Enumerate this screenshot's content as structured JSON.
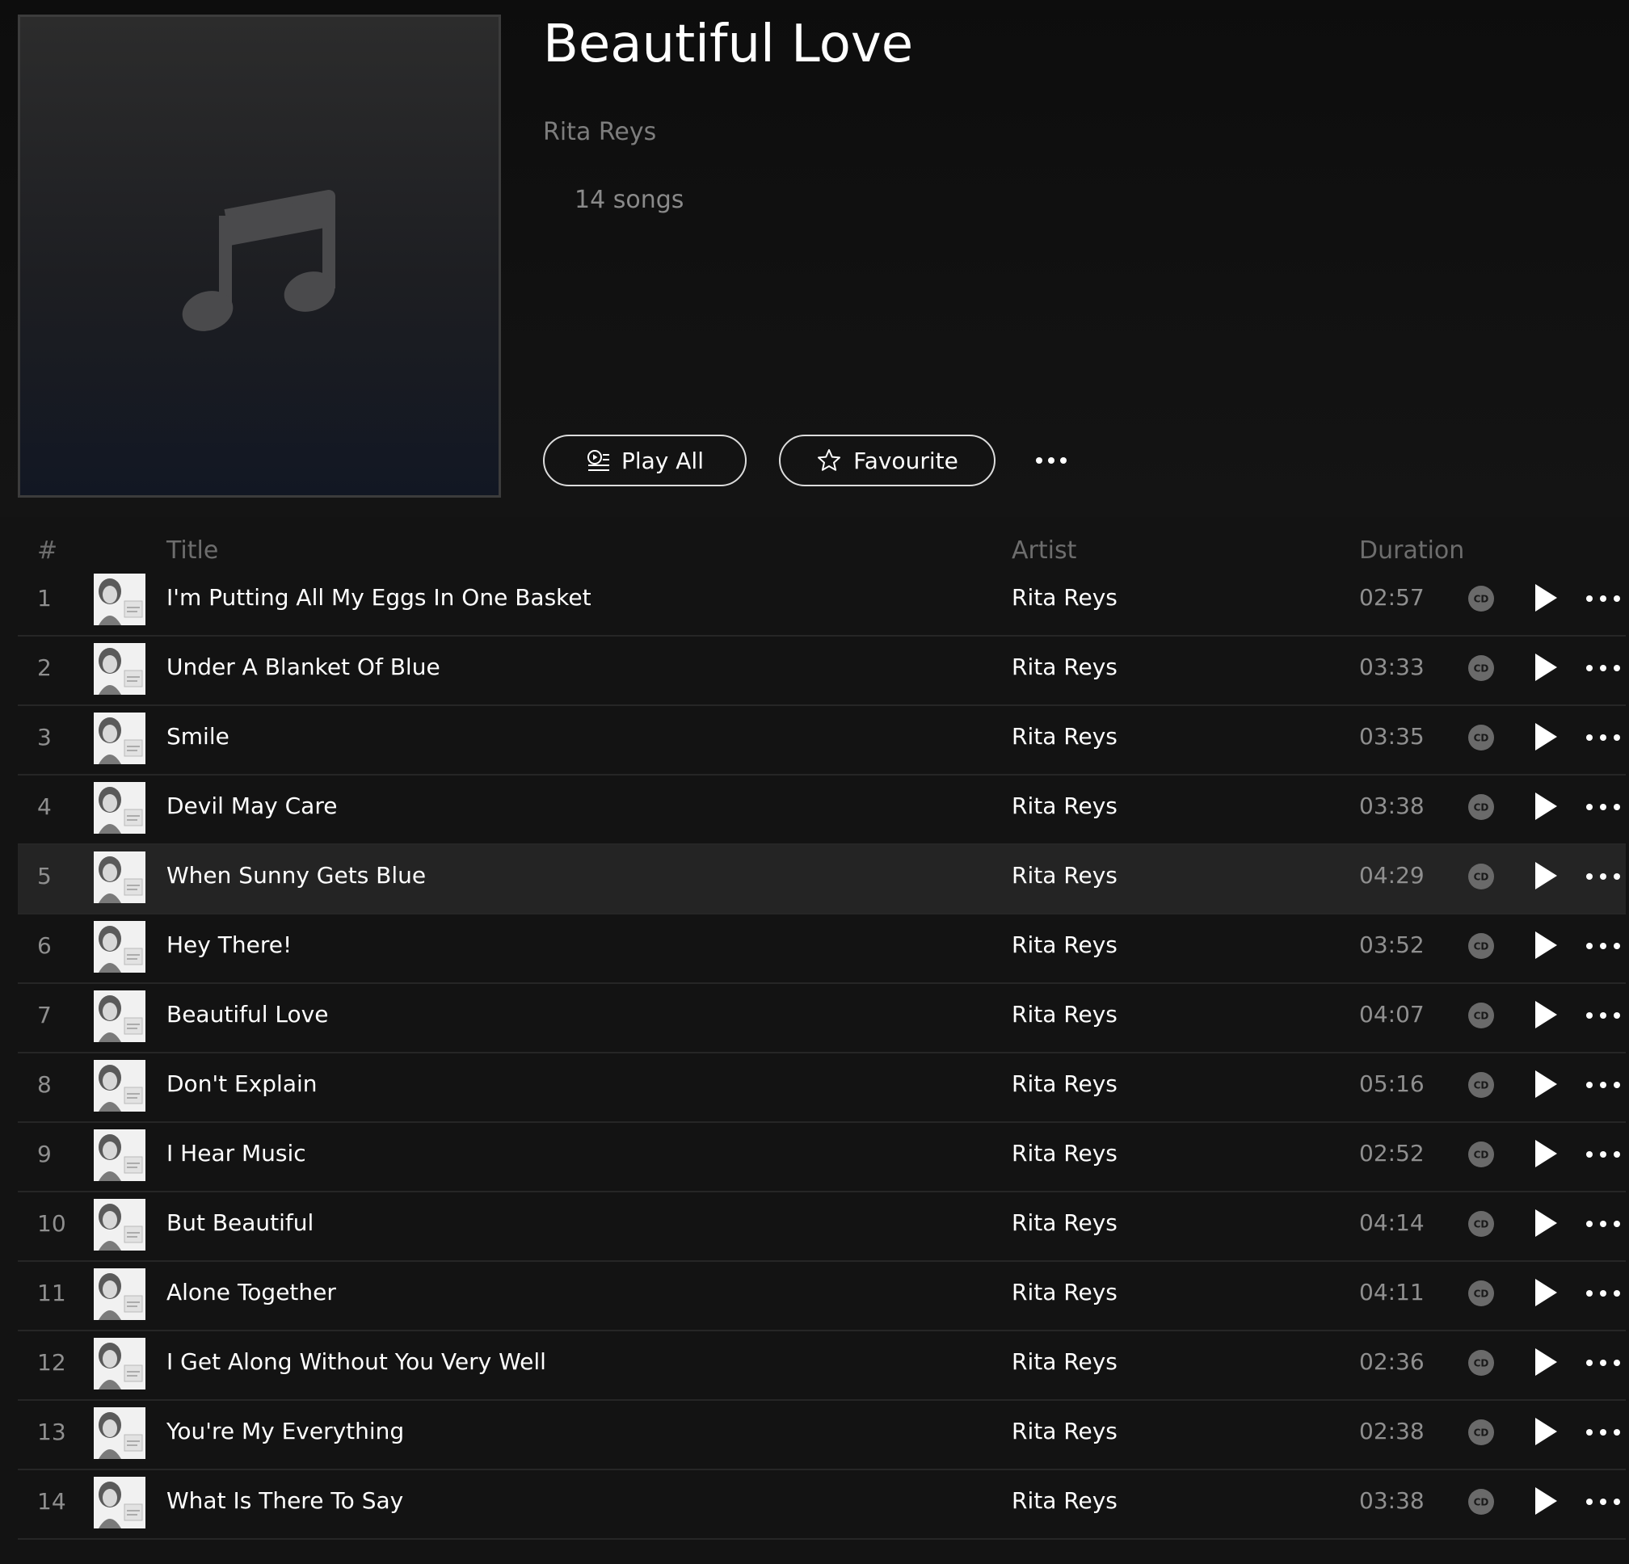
{
  "album": {
    "title": "Beautiful Love",
    "artist": "Rita Reys",
    "song_count": "14 songs"
  },
  "actions": {
    "play_all": "Play All",
    "favourite": "Favourite"
  },
  "columns": {
    "number": "#",
    "title": "Title",
    "artist": "Artist",
    "duration": "Duration"
  },
  "badge": {
    "cd": "CD"
  },
  "colors": {
    "background": "#131313",
    "muted_text": "#8f8f8f",
    "selected_row": "#242424"
  },
  "tracks": [
    {
      "num": "1",
      "title": "I'm Putting All My Eggs In One Basket",
      "artist": "Rita Reys",
      "duration": "02:57"
    },
    {
      "num": "2",
      "title": "Under A Blanket Of Blue",
      "artist": "Rita Reys",
      "duration": "03:33"
    },
    {
      "num": "3",
      "title": "Smile",
      "artist": "Rita Reys",
      "duration": "03:35"
    },
    {
      "num": "4",
      "title": "Devil May Care",
      "artist": "Rita Reys",
      "duration": "03:38"
    },
    {
      "num": "5",
      "title": "When Sunny Gets Blue",
      "artist": "Rita Reys",
      "duration": "04:29"
    },
    {
      "num": "6",
      "title": "Hey There!",
      "artist": "Rita Reys",
      "duration": "03:52"
    },
    {
      "num": "7",
      "title": "Beautiful Love",
      "artist": "Rita Reys",
      "duration": "04:07"
    },
    {
      "num": "8",
      "title": "Don't Explain",
      "artist": "Rita Reys",
      "duration": "05:16"
    },
    {
      "num": "9",
      "title": "I Hear Music",
      "artist": "Rita Reys",
      "duration": "02:52"
    },
    {
      "num": "10",
      "title": "But Beautiful",
      "artist": "Rita Reys",
      "duration": "04:14"
    },
    {
      "num": "11",
      "title": "Alone Together",
      "artist": "Rita Reys",
      "duration": "04:11"
    },
    {
      "num": "12",
      "title": "I Get Along Without You Very Well",
      "artist": "Rita Reys",
      "duration": "02:36"
    },
    {
      "num": "13",
      "title": "You're My Everything",
      "artist": "Rita Reys",
      "duration": "02:38"
    },
    {
      "num": "14",
      "title": "What Is There To Say",
      "artist": "Rita Reys",
      "duration": "03:38"
    }
  ]
}
